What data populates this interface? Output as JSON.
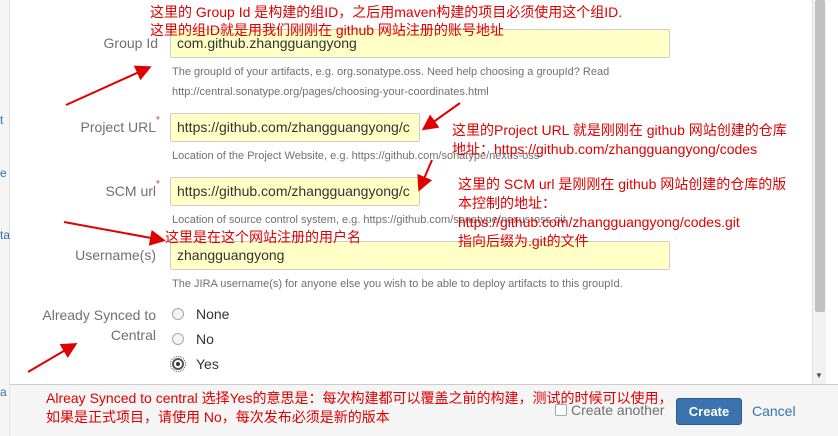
{
  "page_strip": {
    "chars": [
      "t",
      "e",
      "ta",
      "a"
    ]
  },
  "form": {
    "group_id": {
      "label": "Group Id",
      "value": "com.github.zhangguangyong",
      "desc_line1": "The groupId of your artifacts, e.g. org.sonatype.oss. Need help choosing a groupId? Read",
      "desc_line2": "http://central.sonatype.org/pages/choosing-your-coordinates.html"
    },
    "project_url": {
      "label": "Project URL",
      "required_mark": "*",
      "value": "https://github.com/zhangguangyong/c",
      "desc": "Location of the Project Website, e.g. https://github.com/sonatype/nexus-oss"
    },
    "scm_url": {
      "label": "SCM url",
      "required_mark": "*",
      "value": "https://github.com/zhangguangyong/c",
      "desc": "Location of source control system, e.g. https://github.com/sonatype/nexus-oss.git"
    },
    "username": {
      "label": "Username(s)",
      "value": "zhangguangyong",
      "desc": "The JIRA username(s) for anyone else you wish to be able to deploy artifacts to this groupId."
    },
    "already_synced": {
      "label_line1": "Already Synced to",
      "label_line2": "Central",
      "options": [
        "None",
        "No",
        "Yes"
      ],
      "selected": "Yes"
    }
  },
  "footer": {
    "create_another_label": "Create another",
    "create_label": "Create",
    "cancel_label": "Cancel"
  },
  "annotations": {
    "group_id_line1": "这里的 Group Id 是构建的组ID，之后用maven构建的项目必须使用这个组ID.",
    "group_id_line2": "这里的组ID就是用我们刚刚在 github 网站注册的账号地址",
    "project_url_line1": "这里的Project URL 就是刚刚在 github 网站创建的仓库",
    "project_url_line2": "地址：https://github.com/zhangguangyong/codes",
    "scm_line1": "这里的 SCM url 是刚刚在 github 网站创建的仓库的版",
    "scm_line2": "本控制的地址：",
    "scm_line3": "https://github.com/zhangguangyong/codes.git",
    "scm_line4": "指向后缀为.git的文件",
    "username": "这里是在这个网站注册的用户名",
    "synced_line1": "Alreay Synced to central 选择Yes的意思是：每次构建都可以覆盖之前的构建，测试的时候可以使用，",
    "synced_line2": "如果是正式项目，请使用 No，每次发布必须是新的版本"
  },
  "colors": {
    "annotation": "#e00000",
    "input_highlight": "#ffffc6",
    "primary_button": "#3b73af",
    "link": "#3572b0"
  }
}
